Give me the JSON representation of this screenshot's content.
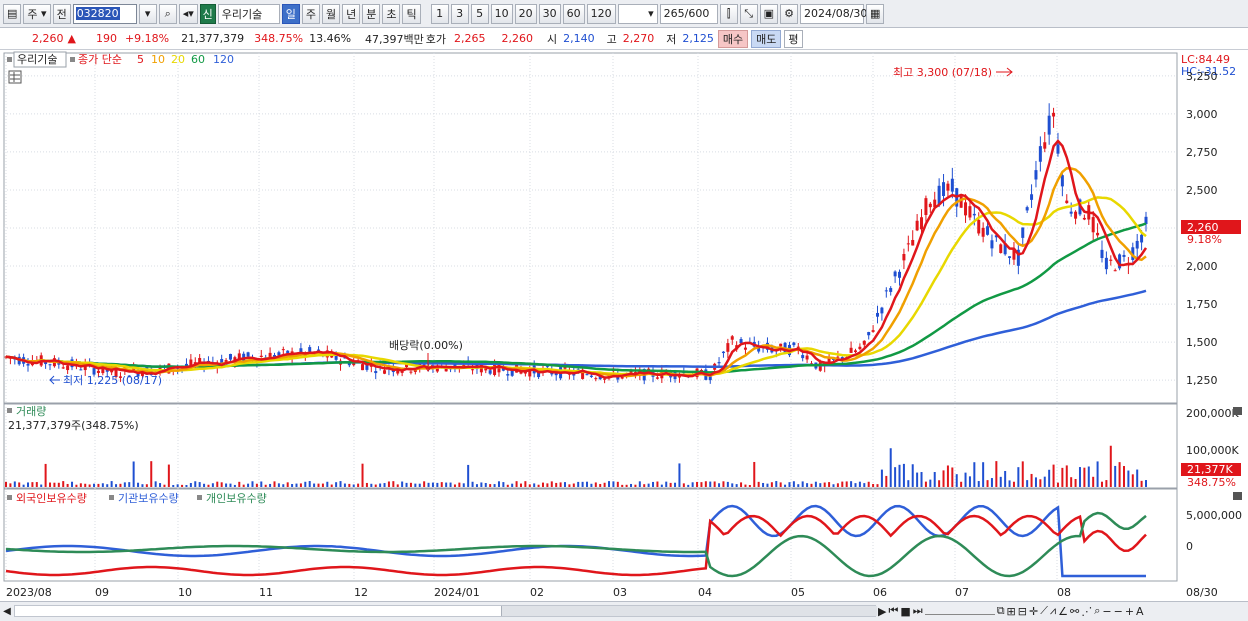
{
  "toolbar": {
    "market": "주",
    "prev": "전",
    "code": "032820",
    "name": "우리기술",
    "credit_badge": "신",
    "periods": [
      "일",
      "주",
      "월",
      "년",
      "분",
      "초",
      "틱"
    ],
    "active_period": "일",
    "intervals": [
      "1",
      "3",
      "5",
      "10",
      "20",
      "30",
      "60",
      "120"
    ],
    "count": "265",
    "count_total": "/600",
    "date": "2024/08/30"
  },
  "quote": {
    "price": "2,260",
    "change_arrow": "▲",
    "change": "190",
    "change_pct": "+9.18%",
    "volume": "21,377,379",
    "volume_ratio": "348.75%",
    "turnover": "13.46%",
    "amount": "47,397백만",
    "ask_label": "호가",
    "ask1": "2,265",
    "ask2": "2,260",
    "open_label": "시",
    "open": "2,140",
    "high_label": "고",
    "high": "2,270",
    "low_label": "저",
    "low": "2,125",
    "buy_label": "매수",
    "sell_label": "매도",
    "flat_label": "평"
  },
  "price_pane": {
    "stock_label": "우리기술",
    "ma_label": "종가 단순",
    "ma_periods": [
      "5",
      "10",
      "20",
      "60",
      "120"
    ],
    "ma_colors": [
      "#e0161b",
      "#f0a000",
      "#e8d800",
      "#119944",
      "#2f5fd8"
    ],
    "high_marker": "최고 3,300 (07/18)",
    "low_marker": "최저 1,225 (08/17)",
    "dividend_marker": "배당락(0.00%)",
    "lc_label": "LC:84.49",
    "hc_label": "HC:-31.52",
    "axis": [
      "3,250",
      "3,000",
      "2,750",
      "2,500",
      "2,250",
      "2,000",
      "1,750",
      "1,500",
      "1,250"
    ],
    "current_price": "2,260",
    "current_pct": "9.18%"
  },
  "volume_pane": {
    "title": "거래량",
    "value": "21,377,379주(348.75%)",
    "axis": [
      "200,000K",
      "100,000K"
    ],
    "current": "21,377K",
    "current_pct": "348.75%"
  },
  "holding_pane": {
    "legends": [
      {
        "label": "외국인보유수량",
        "color": "#e0161b"
      },
      {
        "label": "기관보유수량",
        "color": "#2f5fd8"
      },
      {
        "label": "개인보유수량",
        "color": "#2e8b57"
      }
    ],
    "axis": [
      "5,000,000",
      "0"
    ]
  },
  "x_axis": [
    "2023/08",
    "09",
    "10",
    "11",
    "12",
    "2024/01",
    "02",
    "03",
    "04",
    "05",
    "06",
    "07",
    "08",
    "08/30"
  ]
}
